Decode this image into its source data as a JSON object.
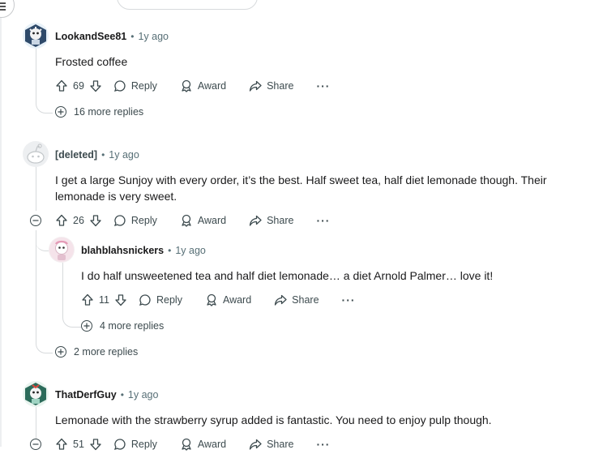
{
  "comments": [
    {
      "author": "LookandSee81",
      "time": "1y ago",
      "body": "Frosted coffee",
      "votes": "69",
      "more_replies": "16 more replies"
    },
    {
      "author": "[deleted]",
      "time": "1y ago",
      "body": "I get a large Sunjoy with every order, it’s the best. Half sweet tea, half diet lemonade though. Their lemonade is very sweet.",
      "votes": "26",
      "more_replies": "2 more replies",
      "reply": {
        "author": "blahblahsnickers",
        "time": "1y ago",
        "body": "I do half unsweetened tea and half diet lemonade… a diet Arnold Palmer… love it!",
        "votes": "11",
        "more_replies": "4 more replies"
      }
    },
    {
      "author": "ThatDerfGuy",
      "time": "1y ago",
      "body": "Lemonade with the strawberry syrup added is fantastic. You need to enjoy pulp though.",
      "votes": "51"
    }
  ],
  "labels": {
    "dot": "•",
    "reply": "Reply",
    "award": "Award",
    "share": "Share",
    "more": "···"
  },
  "colors": {
    "text": "#1a1a1b",
    "meta": "#576f76",
    "action": "#3c4a4e",
    "thread": "#d7dadc"
  }
}
